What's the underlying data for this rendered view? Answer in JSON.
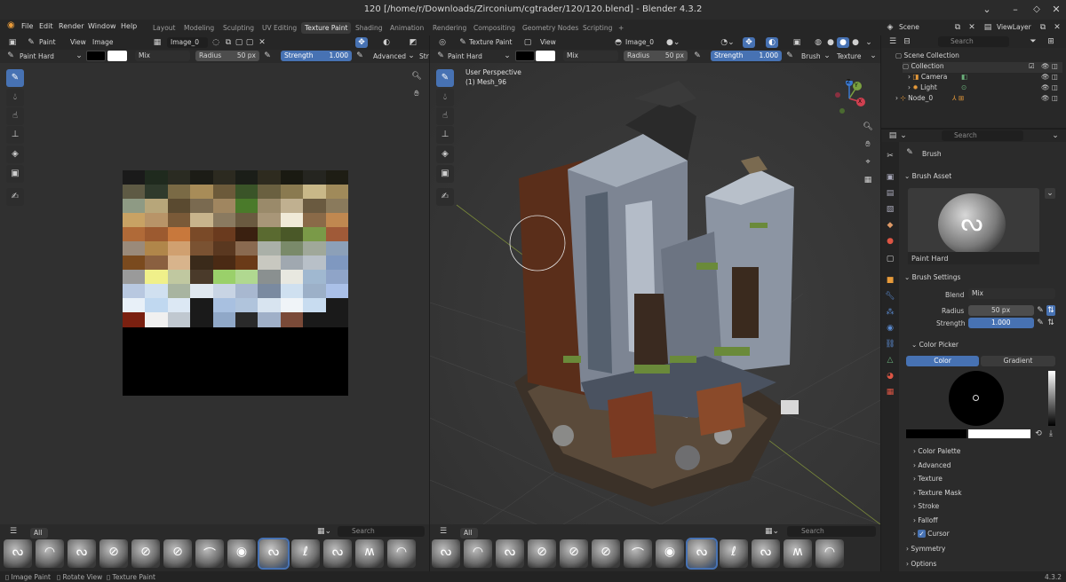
{
  "window": {
    "title": "120 [/home/r/Downloads/Zirconium/cgtrader/120/120.blend] - Blender 4.3.2"
  },
  "menu": {
    "items": [
      "File",
      "Edit",
      "Render",
      "Window",
      "Help"
    ]
  },
  "workspaces": {
    "tabs": [
      "Layout",
      "Modeling",
      "Sculpting",
      "UV Editing",
      "Texture Paint",
      "Shading",
      "Animation",
      "Rendering",
      "Compositing",
      "Geometry Nodes",
      "Scripting"
    ],
    "active": "Texture Paint",
    "add_label": "+"
  },
  "scene": {
    "name": "Scene",
    "view_layer": "ViewLayer"
  },
  "image_editor": {
    "mode": "Paint",
    "view": "View",
    "image_menu": "Image",
    "image_name": "Image_0",
    "brush": "Paint Hard",
    "blend": "Mix",
    "radius_label": "Radius",
    "radius_value": "50 px",
    "strength_label": "Strength",
    "strength_value": "1.000",
    "advanced": "Advanced",
    "truncated": "Str",
    "shelf_tab": "All",
    "search_placeholder": "Search"
  },
  "viewport": {
    "mode": "Texture Paint",
    "view": "View",
    "image_name": "Image_0",
    "brush": "Paint Hard",
    "blend": "Mix",
    "radius_label": "Radius",
    "radius_value": "50 px",
    "strength_label": "Strength",
    "strength_value": "1.000",
    "brush_menu": "Brush",
    "texture_menu": "Texture",
    "overlay_line1": "User Perspective",
    "overlay_line2": "(1) Mesh_96",
    "shelf_tab": "All",
    "search_placeholder": "Search",
    "gizmo": {
      "x": "X",
      "y": "Y",
      "z": "Z"
    }
  },
  "outliner": {
    "search_placeholder": "Search",
    "rows": [
      {
        "label": "Scene Collection",
        "depth": 0
      },
      {
        "label": "Collection",
        "depth": 1
      },
      {
        "label": "Camera",
        "depth": 2
      },
      {
        "label": "Light",
        "depth": 2
      },
      {
        "label": "Node_0",
        "depth": 1
      }
    ]
  },
  "properties": {
    "search_placeholder": "Search",
    "brush_header": "Brush",
    "brush_asset_section": "Brush Asset",
    "brush_asset_name": "Paint Hard",
    "brush_settings_section": "Brush Settings",
    "blend_label": "Blend",
    "blend_value": "Mix",
    "radius_label": "Radius",
    "radius_value": "50 px",
    "strength_label": "Strength",
    "strength_value": "1.000",
    "color_picker_section": "Color Picker",
    "color_tab": "Color",
    "gradient_tab": "Gradient",
    "collapsed_sections": [
      "Color Palette",
      "Advanced",
      "Texture",
      "Texture Mask",
      "Stroke",
      "Falloff",
      "Cursor"
    ],
    "bottom_sections": [
      "Symmetry",
      "Options"
    ]
  },
  "status": {
    "items": [
      "Image Paint",
      "Rotate View",
      "Texture Paint"
    ],
    "version": "4.3.2"
  },
  "colors": {
    "accent": "#4772b3",
    "primary_color": "#000000",
    "secondary_color": "#ffffff"
  },
  "texture_palette": [
    [
      "#1a1a1a",
      "#1f2a1e",
      "#2a2b22",
      "#1c1c16",
      "#2c2a20",
      "#1b1e18",
      "#2e2b1f",
      "#1a1a12",
      "#252520",
      "#1e1d14"
    ],
    [
      "#5e5a44",
      "#2f3a2c",
      "#7a6a45",
      "#a88c58",
      "#6c5a3a",
      "#3a5428",
      "#6a6040",
      "#8a7a50",
      "#c9b888",
      "#a08a5a"
    ],
    [
      "#8e9a84",
      "#b7a67a",
      "#5a4a30",
      "#7a6a50",
      "#a08660",
      "#4a7a2a",
      "#9a8a6a",
      "#c0b090",
      "#6a5a40",
      "#8a7a5c"
    ],
    [
      "#c8a264",
      "#b89468",
      "#7a5a38",
      "#c8b48c",
      "#8a7a60",
      "#6a5a40",
      "#a89678",
      "#f0ead8",
      "#8a6a48",
      "#c08850"
    ],
    [
      "#b06a38",
      "#9c5a30",
      "#c8783c",
      "#7a4a28",
      "#6a3a1e",
      "#3a2010",
      "#5a6a30",
      "#4a5828",
      "#7a9a48",
      "#a05a38"
    ],
    [
      "#9a8a7a",
      "#b0864a",
      "#d0a070",
      "#7a5232",
      "#5a3820",
      "#8a6a50",
      "#aab0a8",
      "#7a8a6a",
      "#a0a89a",
      "#8ca0b8"
    ],
    [
      "#7a4a1e",
      "#8a6040",
      "#d8b48c",
      "#3a2a1a",
      "#4a2a14",
      "#6a3a18",
      "#c8c8c0",
      "#a0a8b0",
      "#b8c0c8",
      "#7f98c0"
    ],
    [
      "#9a9a9a",
      "#f0f08a",
      "#c0c8a0",
      "#4a3a2a",
      "#9ad06a",
      "#b0d890",
      "#8a9090",
      "#e8e8e0",
      "#a0b8d0",
      "#8fa4c8"
    ],
    [
      "#b8c8e0",
      "#d0e0f0",
      "#a8b4a0",
      "#e0e8f0",
      "#c8d4e4",
      "#a8b8d0",
      "#7a8aa0",
      "#cfe0f0",
      "#9cb0c8",
      "#aac0e8"
    ],
    [
      "#e8f0f8",
      "#c0d8f0",
      "#dce8f4",
      "#1a1a1a",
      "#a8c0e0",
      "#b0c4dc",
      "#d8e4f0",
      "#f0f4f8",
      "#c8dcf0",
      "#1a1a1a"
    ],
    [
      "#7a2010",
      "#f0f0f0",
      "#c0c8d0",
      "#1a1a1a",
      "#90a8c8",
      "#2a2a2a",
      "#a0b0c8",
      "#7a4a38",
      "#1a1a1a",
      "#1a1a1a"
    ]
  ]
}
